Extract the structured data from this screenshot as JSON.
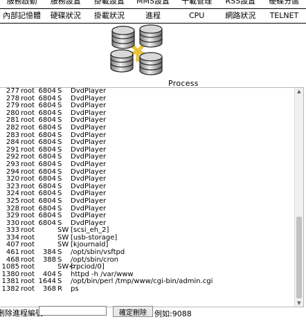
{
  "nav_top": [
    "服務啟動",
    "服務設置",
    "掛載設置",
    "MMS設置",
    "十載管理",
    "RSS設置",
    "硬碟分區"
  ],
  "nav_main": [
    "內部記憶體",
    "硬碟狀況",
    "掛載狀況",
    "進程",
    "CPU",
    "網路狀況",
    "TELNET"
  ],
  "logo_icon": "database-cluster-icon",
  "process_title": "Process",
  "processes": [
    {
      "pid": "277",
      "user": "root",
      "vsz": "6804",
      "stat": "S",
      "cmd": "DvdPlayer"
    },
    {
      "pid": "278",
      "user": "root",
      "vsz": "6804",
      "stat": "S",
      "cmd": "DvdPlayer"
    },
    {
      "pid": "279",
      "user": "root",
      "vsz": "6804",
      "stat": "S",
      "cmd": "DvdPlayer"
    },
    {
      "pid": "280",
      "user": "root",
      "vsz": "6804",
      "stat": "S",
      "cmd": "DvdPlayer"
    },
    {
      "pid": "281",
      "user": "root",
      "vsz": "6804",
      "stat": "S",
      "cmd": "DvdPlayer"
    },
    {
      "pid": "282",
      "user": "root",
      "vsz": "6804",
      "stat": "S",
      "cmd": "DvdPlayer"
    },
    {
      "pid": "283",
      "user": "root",
      "vsz": "6804",
      "stat": "S",
      "cmd": "DvdPlayer"
    },
    {
      "pid": "284",
      "user": "root",
      "vsz": "6804",
      "stat": "S",
      "cmd": "DvdPlayer"
    },
    {
      "pid": "291",
      "user": "root",
      "vsz": "6804",
      "stat": "S",
      "cmd": "DvdPlayer"
    },
    {
      "pid": "292",
      "user": "root",
      "vsz": "6804",
      "stat": "S",
      "cmd": "DvdPlayer"
    },
    {
      "pid": "293",
      "user": "root",
      "vsz": "6804",
      "stat": "S",
      "cmd": "DvdPlayer"
    },
    {
      "pid": "294",
      "user": "root",
      "vsz": "6804",
      "stat": "S",
      "cmd": "DvdPlayer"
    },
    {
      "pid": "320",
      "user": "root",
      "vsz": "6804",
      "stat": "S",
      "cmd": "DvdPlayer"
    },
    {
      "pid": "323",
      "user": "root",
      "vsz": "6804",
      "stat": "S",
      "cmd": "DvdPlayer"
    },
    {
      "pid": "324",
      "user": "root",
      "vsz": "6804",
      "stat": "S",
      "cmd": "DvdPlayer"
    },
    {
      "pid": "325",
      "user": "root",
      "vsz": "6804",
      "stat": "S",
      "cmd": "DvdPlayer"
    },
    {
      "pid": "328",
      "user": "root",
      "vsz": "6804",
      "stat": "S",
      "cmd": "DvdPlayer"
    },
    {
      "pid": "329",
      "user": "root",
      "vsz": "6804",
      "stat": "S",
      "cmd": "DvdPlayer"
    },
    {
      "pid": "330",
      "user": "root",
      "vsz": "6804",
      "stat": "S",
      "cmd": "DvdPlayer"
    },
    {
      "pid": "333",
      "user": "root",
      "vsz": "",
      "stat": "SW",
      "cmd": "[scsi_eh_2]"
    },
    {
      "pid": "334",
      "user": "root",
      "vsz": "",
      "stat": "SW",
      "cmd": "[usb-storage]"
    },
    {
      "pid": "407",
      "user": "root",
      "vsz": "",
      "stat": "SW",
      "cmd": "[kjournald]"
    },
    {
      "pid": "461",
      "user": "root",
      "vsz": "384",
      "stat": "S",
      "cmd": "/opt/sbin/vsftpd"
    },
    {
      "pid": "468",
      "user": "root",
      "vsz": "388",
      "stat": "S",
      "cmd": "/opt/sbin/cron"
    },
    {
      "pid": "1085",
      "user": "root",
      "vsz": "",
      "stat": "SW<",
      "cmd": "[rpciod/0]"
    },
    {
      "pid": "1380",
      "user": "root",
      "vsz": "404",
      "stat": "S",
      "cmd": "httpd -h /var/www"
    },
    {
      "pid": "1381",
      "user": "root",
      "vsz": "1644",
      "stat": "S",
      "cmd": "/opt/bin/perl /tmp/www/cgi-bin/admin.cgi"
    },
    {
      "pid": "1382",
      "user": "root",
      "vsz": "368",
      "stat": "R",
      "cmd": "ps"
    }
  ],
  "form": {
    "kill_label": "刪除進程編號:",
    "pid_value": "",
    "confirm_label": "確定刪除",
    "example_text": "例如:9088"
  }
}
